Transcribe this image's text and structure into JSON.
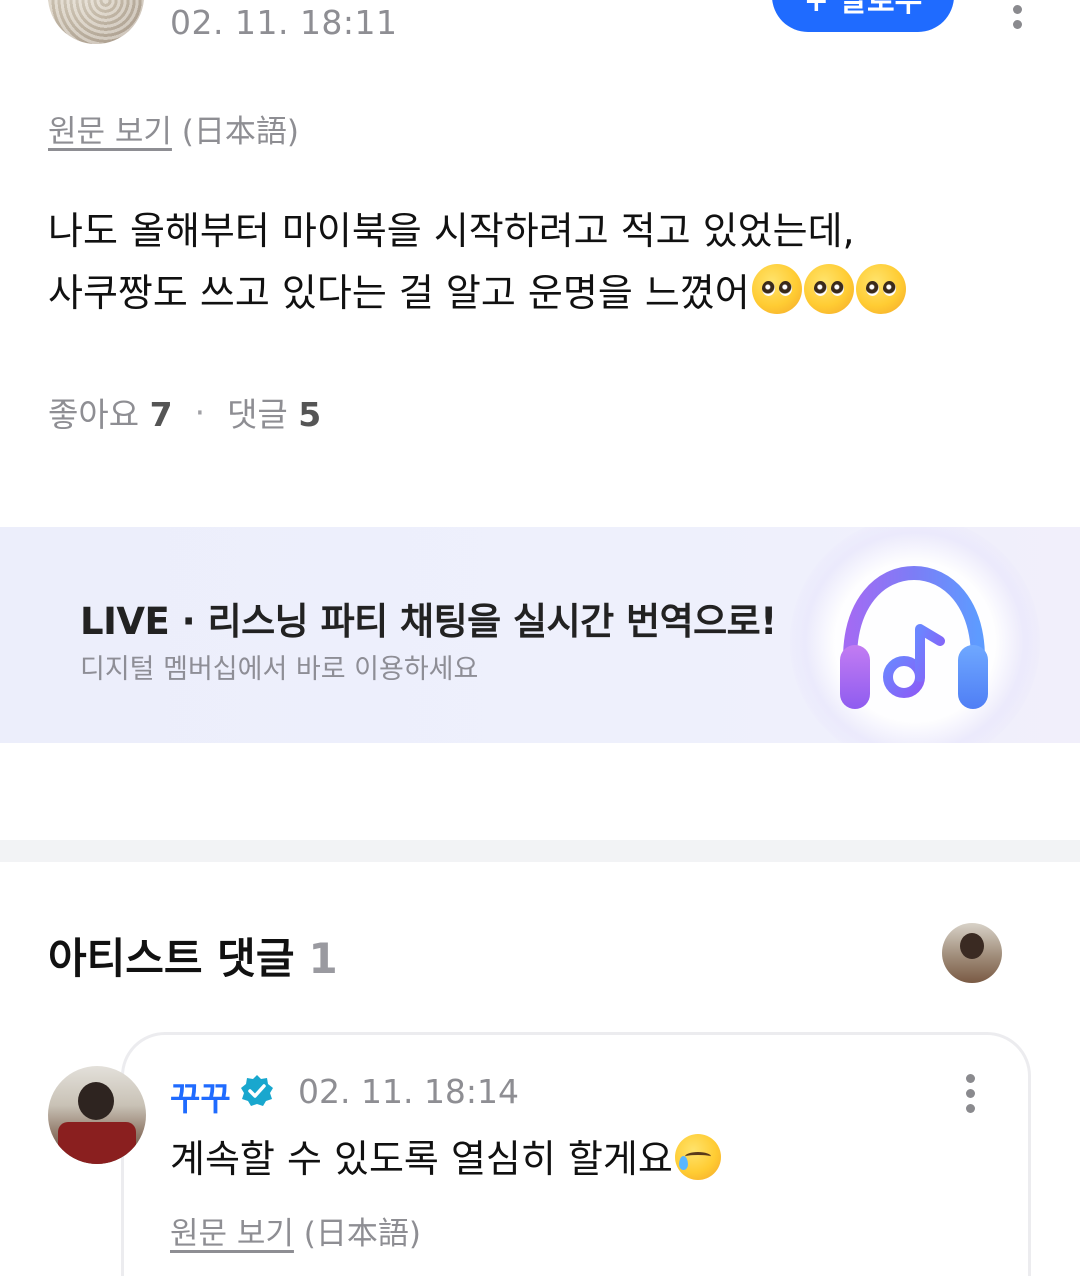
{
  "post": {
    "timestamp": "02. 11. 18:11",
    "follow_label": "+ 팔로우",
    "original_link": "원문 보기",
    "original_lang": "(日本語)",
    "body_line1": "나도 올해부터 마이북을 시작하려고 적고 있었는데,",
    "body_line2": "사쿠짱도 쓰고 있다는 걸 알고 운명을 느꼈어",
    "emoji_count": 3,
    "likes_label": "좋아요",
    "likes_count": "7",
    "comments_label": "댓글",
    "comments_count": "5"
  },
  "banner": {
    "title": "LIVE · 리스닝 파티 채팅을 실시간 번역으로!",
    "subtitle": "디지털 멤버십에서 바로 이용하세요",
    "icon": "headphones-music-icon",
    "accent_colors": [
      "#7b5cf5",
      "#5a8dff",
      "#c46bf0"
    ]
  },
  "artist_comments": {
    "title": "아티스트 댓글",
    "count": "1",
    "items": [
      {
        "name": "꾸꾸",
        "verified": true,
        "timestamp": "02. 11. 18:14",
        "text": "계속할 수 있도록 열심히 할게요",
        "original_link": "원문 보기",
        "original_lang": "(日本語)"
      }
    ]
  },
  "colors": {
    "accent": "#1f6bff",
    "verified": "#19a7ce",
    "muted_text": "#8e8e93"
  }
}
